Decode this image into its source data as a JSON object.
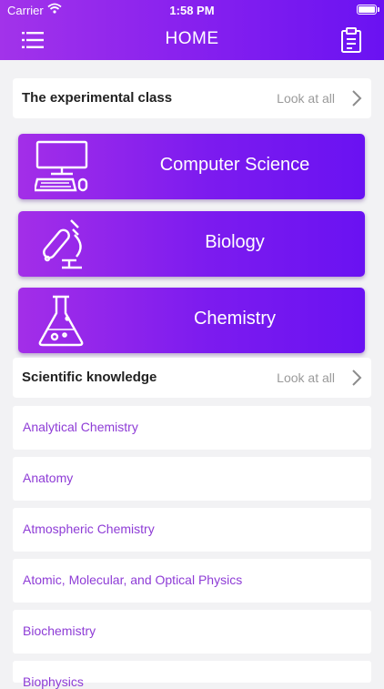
{
  "status_bar": {
    "carrier": "Carrier",
    "time": "1:58 PM"
  },
  "nav": {
    "title": "HOME"
  },
  "experimental": {
    "title": "The experimental class",
    "more": "Look at all"
  },
  "categories": [
    {
      "label": "Computer Science",
      "icon": "computer-icon"
    },
    {
      "label": "Biology",
      "icon": "microscope-icon"
    },
    {
      "label": "Chemistry",
      "icon": "flask-icon"
    }
  ],
  "knowledge": {
    "title": "Scientific knowledge",
    "more": "Look at all",
    "items": [
      "Analytical Chemistry",
      "Anatomy",
      "Atmospheric Chemistry",
      "Atomic, Molecular, and Optical Physics",
      "Biochemistry",
      "Biophysics"
    ]
  },
  "colors": {
    "accent": "#8a22ee",
    "link": "#8e3cd6",
    "background": "#f2f2f4"
  }
}
